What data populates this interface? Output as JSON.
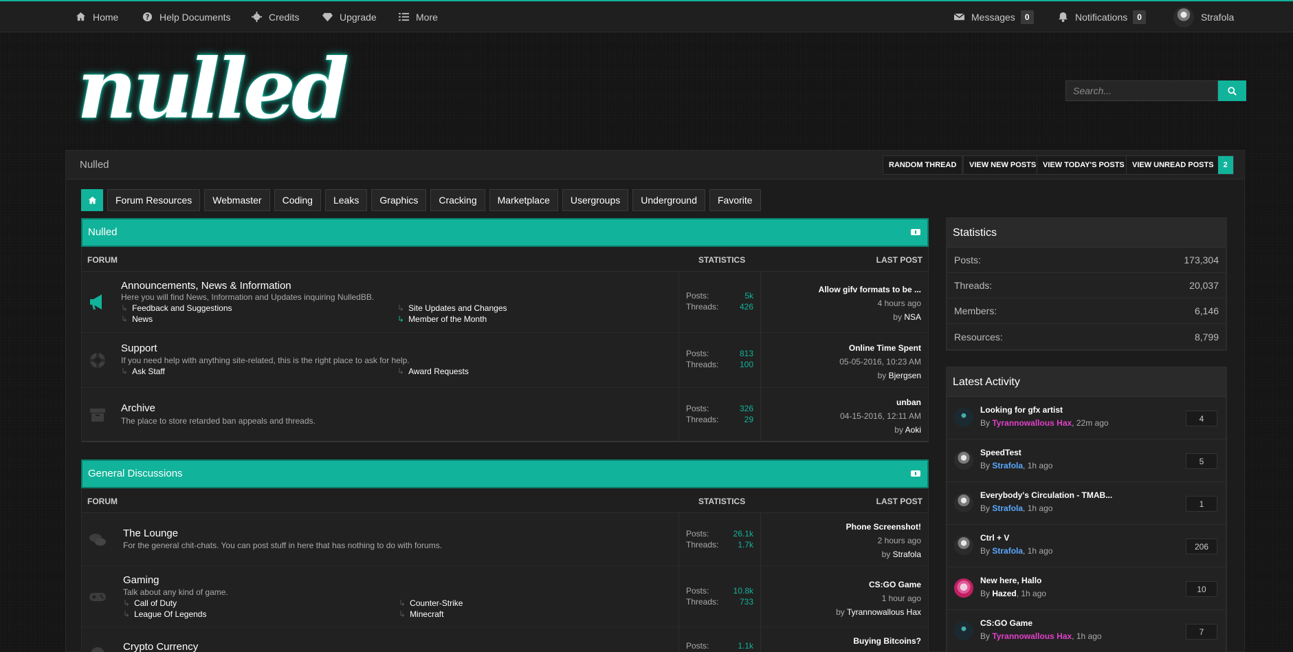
{
  "topnav": {
    "home": "Home",
    "help": "Help Documents",
    "credits": "Credits",
    "upgrade": "Upgrade",
    "more": "More",
    "messages": "Messages",
    "messages_count": "0",
    "notifications": "Notifications",
    "notifications_count": "0",
    "username": "Strafola"
  },
  "header": {
    "logo": "nulled",
    "search_placeholder": "Search..."
  },
  "breadcrumb": "Nulled",
  "quick_links": {
    "random": "RANDOM THREAD",
    "new_posts": "VIEW NEW POSTS",
    "today": "VIEW TODAY'S POSTS",
    "unread": "VIEW UNREAD POSTS",
    "unread_count": "2"
  },
  "tabs": [
    "Forum Resources",
    "Webmaster",
    "Coding",
    "Leaks",
    "Graphics",
    "Cracking",
    "Marketplace",
    "Usergroups",
    "Underground",
    "Favorite"
  ],
  "columns": {
    "forum": "FORUM",
    "statistics": "STATISTICS",
    "last_post": "LAST POST"
  },
  "labels": {
    "posts": "Posts:",
    "threads": "Threads:",
    "by": "by"
  },
  "sections": [
    {
      "title": "Nulled",
      "forums": [
        {
          "name": "Announcements, News & Information",
          "desc": "Here you will find News, Information and Updates inquiring NulledBB.",
          "subs": [
            "Feedback and Suggestions",
            "Site Updates and Changes",
            "News",
            "Member of the Month"
          ],
          "posts": "5k",
          "threads": "426",
          "last_title": "Allow gifv formats to be ...",
          "last_date": "4 hours ago",
          "last_by": "NSA"
        },
        {
          "name": "Support",
          "desc": "If you need help with anything site-related, this is the right place to ask for help.",
          "subs": [
            "Ask Staff",
            "Award Requests"
          ],
          "posts": "813",
          "threads": "100",
          "last_title": "Online Time Spent",
          "last_date": "05-05-2016, 10:23 AM",
          "last_by": "Bjergsen"
        },
        {
          "name": "Archive",
          "desc": "The place to store retarded ban appeals and threads.",
          "posts": "326",
          "threads": "29",
          "last_title": "unban",
          "last_date": "04-15-2016, 12:11 AM",
          "last_by": "Aoki"
        }
      ]
    },
    {
      "title": "General Discussions",
      "forums": [
        {
          "name": "The Lounge",
          "desc": "For the general chit-chats. You can post stuff in here that has nothing to do with forums.",
          "posts": "26.1k",
          "threads": "1.7k",
          "last_title": "Phone Screenshot!",
          "last_date": "2 hours ago",
          "last_by": "Strafola"
        },
        {
          "name": "Gaming",
          "desc": "Talk about any kind of game.",
          "subs": [
            "Call of Duty",
            "Counter-Strike",
            "League Of Legends",
            "Minecraft"
          ],
          "posts": "10.8k",
          "threads": "733",
          "last_title": "CS:GO Game",
          "last_date": "1 hour ago",
          "last_by": "Tyrannowallous Hax"
        },
        {
          "name": "Crypto Currency",
          "posts": "1.1k",
          "last_title": "Buying Bitcoins?"
        }
      ]
    }
  ],
  "statistics": {
    "title": "Statistics",
    "rows": [
      {
        "label": "Posts:",
        "value": "173,304"
      },
      {
        "label": "Threads:",
        "value": "20,037"
      },
      {
        "label": "Members:",
        "value": "6,146"
      },
      {
        "label": "Resources:",
        "value": "8,799"
      }
    ]
  },
  "activity": {
    "title": "Latest Activity",
    "items": [
      {
        "title": "Looking for gfx artist",
        "by": "By",
        "user": "Tyrannowallous Hax",
        "user_color": "#e040c8",
        "time": ", 22m ago",
        "count": "4"
      },
      {
        "title": "SpeedTest",
        "by": "By",
        "user": "Strafola",
        "user_color": "#5aa8ff",
        "time": ", 1h ago",
        "count": "5"
      },
      {
        "title": "Everybody's Circulation - TMAB...",
        "by": "By",
        "user": "Strafola",
        "user_color": "#5aa8ff",
        "time": ", 1h ago",
        "count": "1"
      },
      {
        "title": "Ctrl + V",
        "by": "By",
        "user": "Strafola",
        "user_color": "#5aa8ff",
        "time": ", 1h ago",
        "count": "206"
      },
      {
        "title": "New here, Hallo",
        "by": "By",
        "user": "Hazed",
        "user_color": "#ffffff",
        "time": ", 1h ago",
        "count": "10"
      },
      {
        "title": "CS:GO Game",
        "by": "By",
        "user": "Tyrannowallous Hax",
        "user_color": "#e040c8",
        "time": ", 1h ago",
        "count": "7"
      }
    ]
  },
  "colors": {
    "accent": "#12b39b"
  }
}
